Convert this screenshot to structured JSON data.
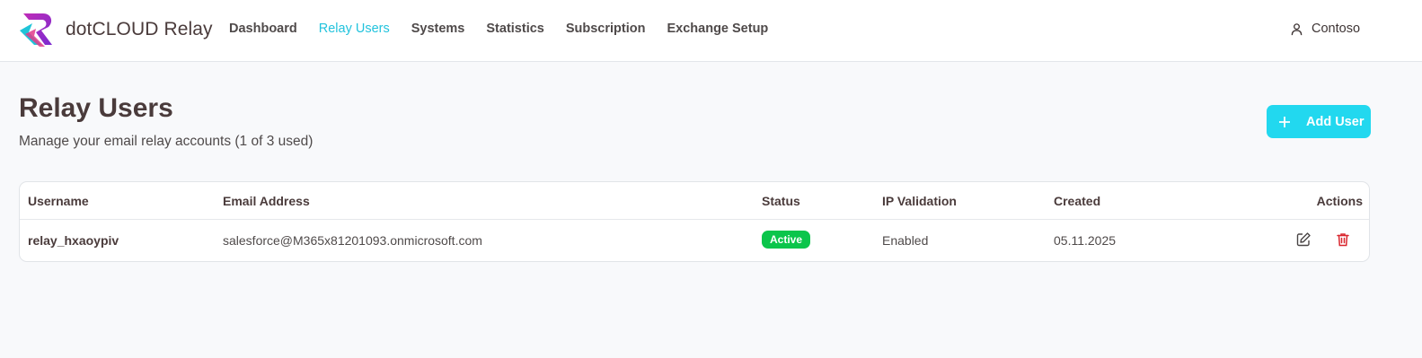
{
  "brand": {
    "name": "dotCLOUD Relay"
  },
  "nav": {
    "items": [
      {
        "label": "Dashboard",
        "active": false
      },
      {
        "label": "Relay Users",
        "active": true
      },
      {
        "label": "Systems",
        "active": false
      },
      {
        "label": "Statistics",
        "active": false
      },
      {
        "label": "Subscription",
        "active": false
      },
      {
        "label": "Exchange Setup",
        "active": false
      }
    ]
  },
  "user": {
    "name": "Contoso",
    "icon": "user-icon"
  },
  "page": {
    "title": "Relay Users",
    "subtitle": "Manage your email relay accounts (1 of 3 used)",
    "add_button": "Add User"
  },
  "table": {
    "columns": [
      "Username",
      "Email Address",
      "Status",
      "IP Validation",
      "Created",
      "Actions"
    ],
    "rows": [
      {
        "username": "relay_hxaoypiv",
        "email": "salesforce@M365x81201093.onmicrosoft.com",
        "status": "Active",
        "ip_validation": "Enabled",
        "created": "05.11.2025",
        "actions": [
          "edit-icon",
          "delete-icon"
        ]
      }
    ]
  },
  "colors": {
    "accent": "#22c3dd",
    "button": "#22d8ef",
    "status_active": "#0bc54b",
    "delete": "#d9262e",
    "text": "#4a3b3b"
  }
}
